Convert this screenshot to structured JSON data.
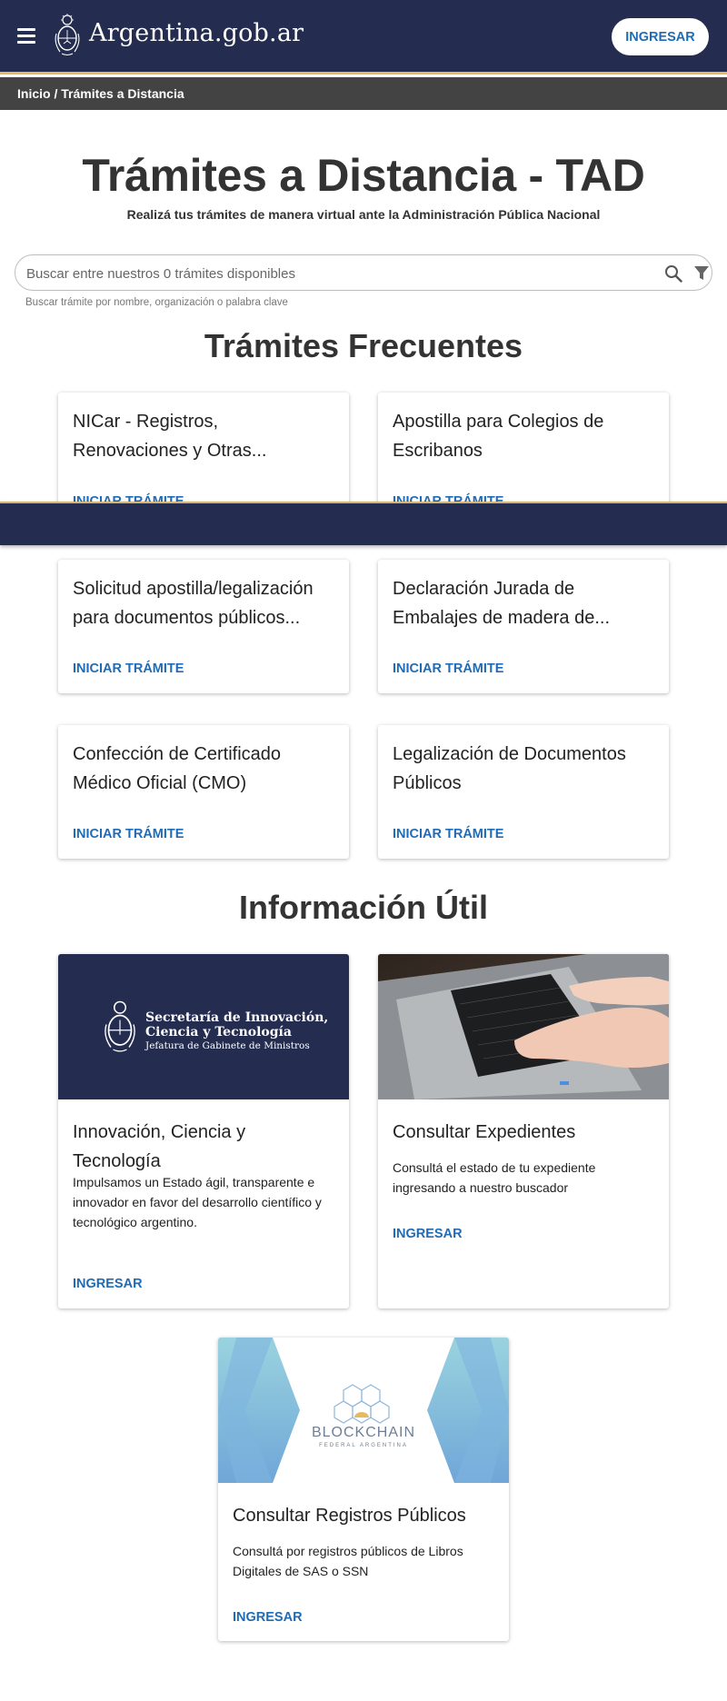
{
  "header": {
    "brand": "Argentina.gob.ar",
    "login_label": "INGRESAR"
  },
  "breadcrumb": {
    "home": "Inicio",
    "separator": " / ",
    "current": "Trámites a Distancia"
  },
  "hero": {
    "title": "Trámites a Distancia - TAD",
    "subtitle": "Realizá tus trámites de manera virtual ante la Administración Pública Nacional"
  },
  "search": {
    "placeholder": "Buscar entre nuestros 0 trámites disponibles",
    "hint": "Buscar trámite por nombre, organización o palabra clave"
  },
  "frecuentes": {
    "title": "Trámites Frecuentes",
    "cards": [
      {
        "title": "NICar - Registros, Renovaciones y Otras...",
        "link": "INICIAR TRÁMITE"
      },
      {
        "title": "Apostilla para Colegios de Escribanos",
        "link": "INICIAR TRÁMITE"
      },
      {
        "title": "Solicitud apostilla/legalización para documentos públicos...",
        "link": "INICIAR TRÁMITE"
      },
      {
        "title": "Declaración Jurada de Embalajes de madera de...",
        "link": "INICIAR TRÁMITE"
      },
      {
        "title": "Confección de Certificado Médico Oficial (CMO)",
        "link": "INICIAR TRÁMITE"
      },
      {
        "title": "Legalización de Documentos Públicos",
        "link": "INICIAR TRÁMITE"
      }
    ]
  },
  "info": {
    "title": "Información Útil",
    "cards": [
      {
        "image_line1": "Secretaría de Innovación,",
        "image_line2": "Ciencia y Tecnología",
        "image_line3": "Jefatura de Gabinete de Ministros",
        "title": "Innovación, Ciencia y Tecnología",
        "description": "Impulsamos un Estado ágil, transparente e innovador en favor del desarrollo científico y tecnológico argentino.",
        "link": "INGRESAR"
      },
      {
        "title": "Consultar Expedientes",
        "description": "Consultá el estado de tu expediente ingresando a nuestro buscador",
        "link": "INGRESAR"
      },
      {
        "image_line1": "BLOCKCHAIN",
        "image_line2": "FEDERAL ARGENTINA",
        "title": "Consultar Registros Públicos",
        "description": "Consultá por registros públicos de Libros Digitales de SAS o SSN",
        "link": "INGRESAR"
      }
    ]
  },
  "colors": {
    "header_bg": "#242c4f",
    "accent_gold": "#e7ba61",
    "link_blue": "#1f6bb5",
    "breadcrumb_bg": "#434343"
  }
}
